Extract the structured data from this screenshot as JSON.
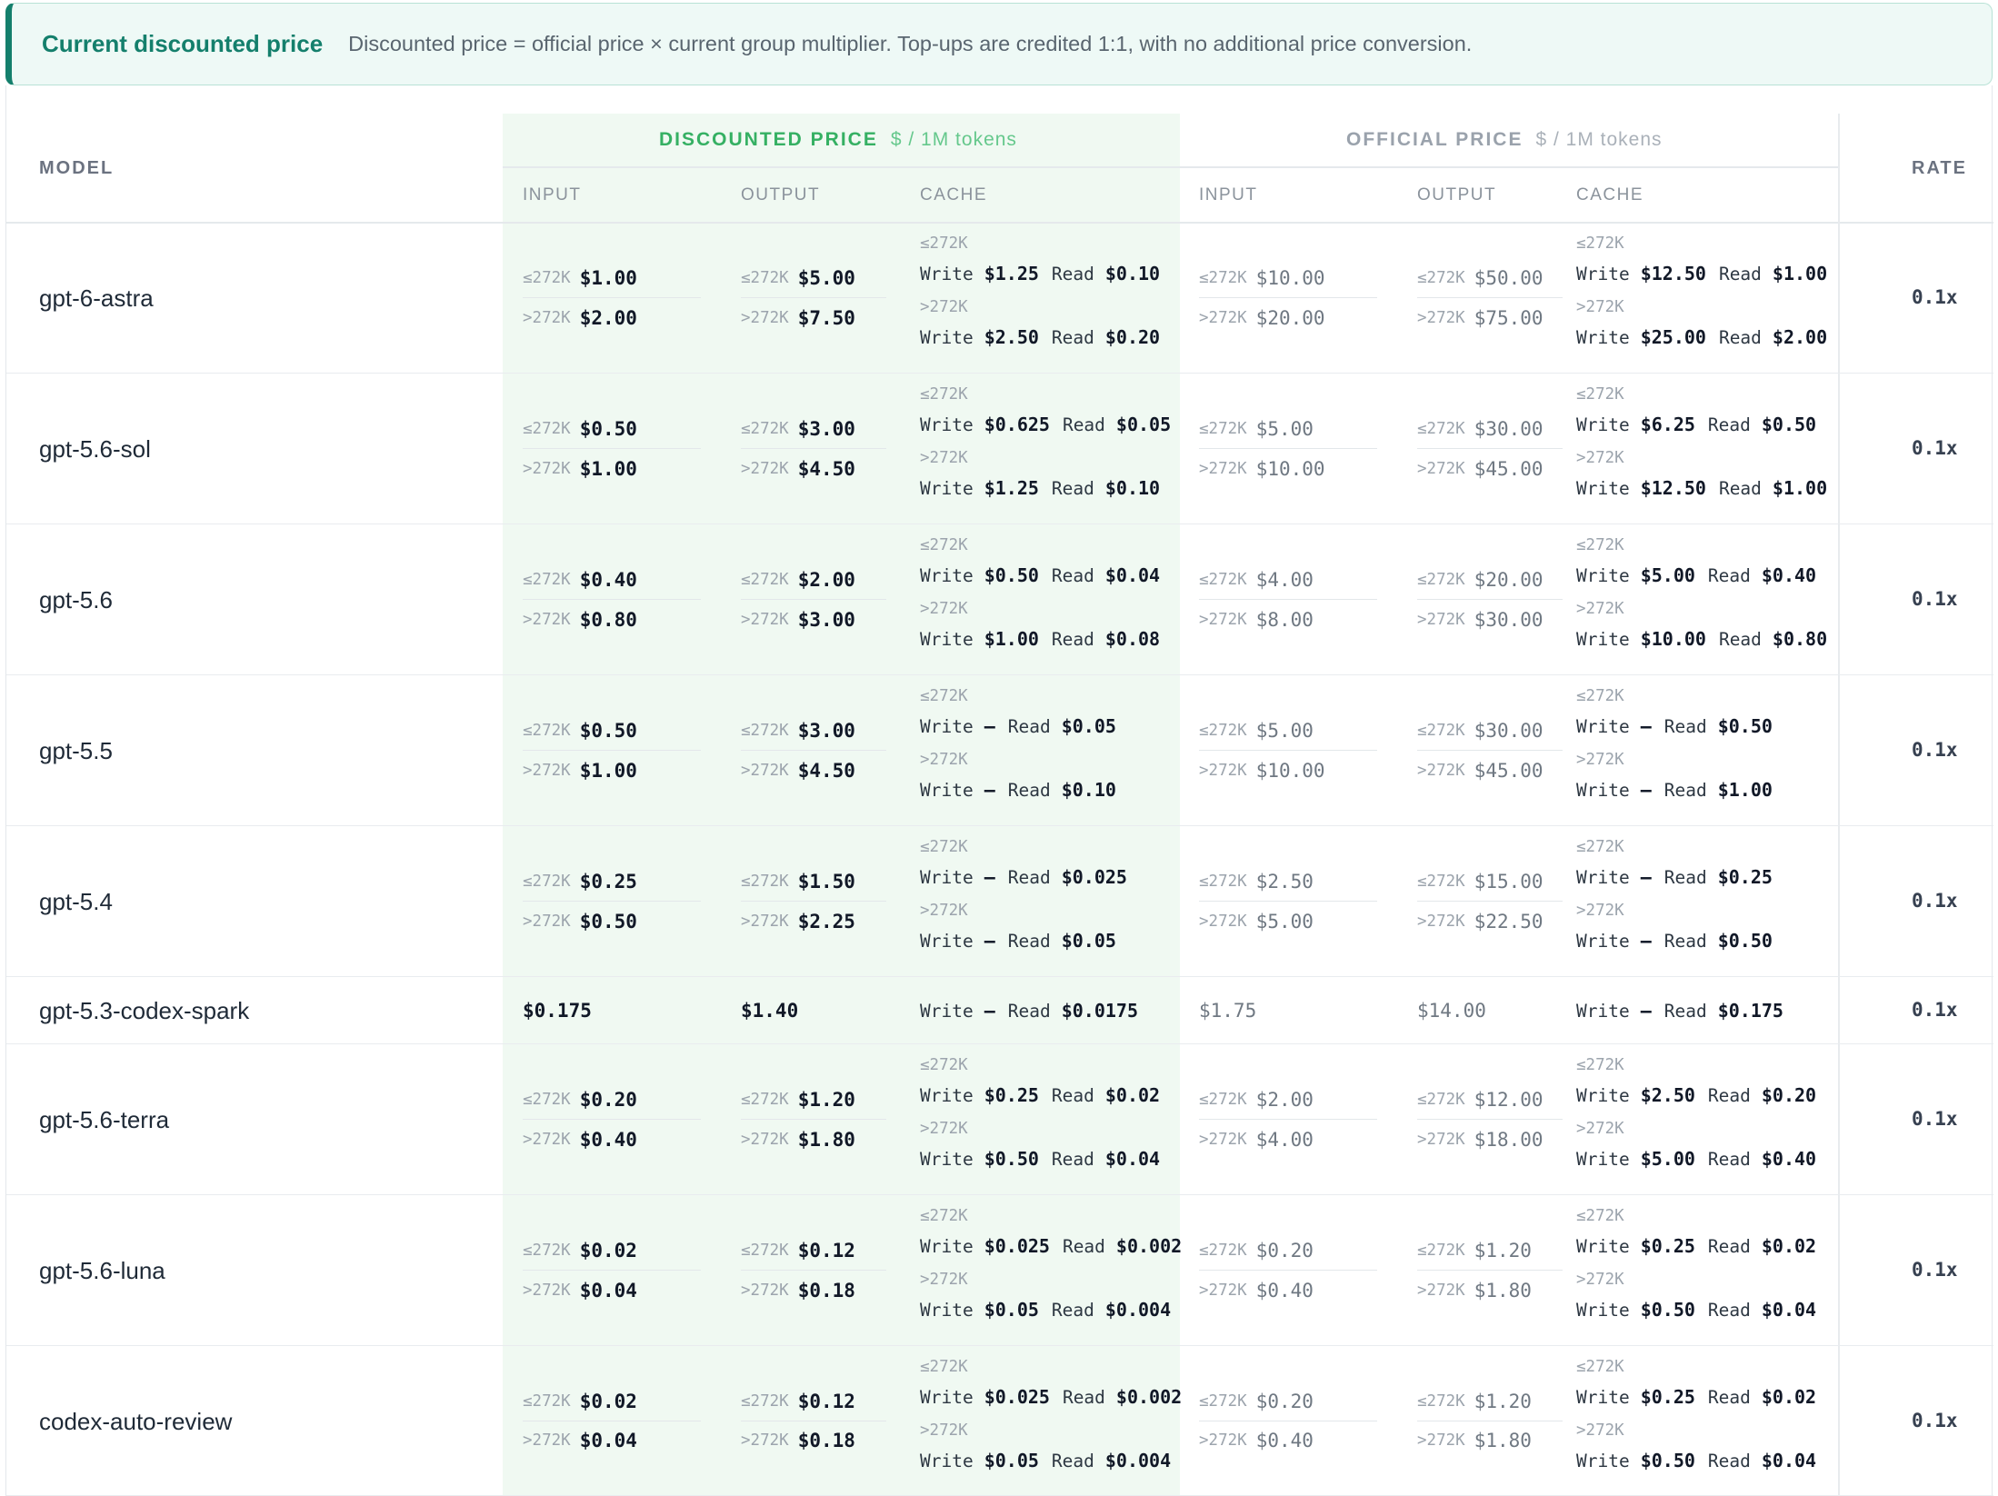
{
  "banner": {
    "title": "Current discounted price",
    "text": "Discounted price = official price × current group multiplier. Top-ups are credited 1:1, with no additional price conversion."
  },
  "header": {
    "model": "MODEL",
    "rate": "RATE",
    "discounted_title": "DISCOUNTED PRICE",
    "discounted_unit": "$ / 1M tokens",
    "official_title": "OFFICIAL PRICE",
    "official_unit": "$ / 1M tokens",
    "input": "INPUT",
    "output": "OUTPUT",
    "cache": "CACHE"
  },
  "labels": {
    "tier_low": "≤272K",
    "tier_high": ">272K",
    "write": "Write",
    "read": "Read"
  },
  "rows": [
    {
      "model": "gpt-6-astra",
      "rate": "0.1x",
      "disc": {
        "input": [
          "$1.00",
          "$2.00"
        ],
        "output": [
          "$5.00",
          "$7.50"
        ],
        "cache": [
          [
            "$1.25",
            "$0.10"
          ],
          [
            "$2.50",
            "$0.20"
          ]
        ]
      },
      "off": {
        "input": [
          "$10.00",
          "$20.00"
        ],
        "output": [
          "$50.00",
          "$75.00"
        ],
        "cache": [
          [
            "$12.50",
            "$1.00"
          ],
          [
            "$25.00",
            "$2.00"
          ]
        ]
      }
    },
    {
      "model": "gpt-5.6-sol",
      "rate": "0.1x",
      "disc": {
        "input": [
          "$0.50",
          "$1.00"
        ],
        "output": [
          "$3.00",
          "$4.50"
        ],
        "cache": [
          [
            "$0.625",
            "$0.05"
          ],
          [
            "$1.25",
            "$0.10"
          ]
        ]
      },
      "off": {
        "input": [
          "$5.00",
          "$10.00"
        ],
        "output": [
          "$30.00",
          "$45.00"
        ],
        "cache": [
          [
            "$6.25",
            "$0.50"
          ],
          [
            "$12.50",
            "$1.00"
          ]
        ]
      }
    },
    {
      "model": "gpt-5.6",
      "rate": "0.1x",
      "disc": {
        "input": [
          "$0.40",
          "$0.80"
        ],
        "output": [
          "$2.00",
          "$3.00"
        ],
        "cache": [
          [
            "$0.50",
            "$0.04"
          ],
          [
            "$1.00",
            "$0.08"
          ]
        ]
      },
      "off": {
        "input": [
          "$4.00",
          "$8.00"
        ],
        "output": [
          "$20.00",
          "$30.00"
        ],
        "cache": [
          [
            "$5.00",
            "$0.40"
          ],
          [
            "$10.00",
            "$0.80"
          ]
        ]
      }
    },
    {
      "model": "gpt-5.5",
      "rate": "0.1x",
      "disc": {
        "input": [
          "$0.50",
          "$1.00"
        ],
        "output": [
          "$3.00",
          "$4.50"
        ],
        "cache": [
          [
            "–",
            "$0.05"
          ],
          [
            "–",
            "$0.10"
          ]
        ]
      },
      "off": {
        "input": [
          "$5.00",
          "$10.00"
        ],
        "output": [
          "$30.00",
          "$45.00"
        ],
        "cache": [
          [
            "–",
            "$0.50"
          ],
          [
            "–",
            "$1.00"
          ]
        ]
      }
    },
    {
      "model": "gpt-5.4",
      "rate": "0.1x",
      "disc": {
        "input": [
          "$0.25",
          "$0.50"
        ],
        "output": [
          "$1.50",
          "$2.25"
        ],
        "cache": [
          [
            "–",
            "$0.025"
          ],
          [
            "–",
            "$0.05"
          ]
        ]
      },
      "off": {
        "input": [
          "$2.50",
          "$5.00"
        ],
        "output": [
          "$15.00",
          "$22.50"
        ],
        "cache": [
          [
            "–",
            "$0.25"
          ],
          [
            "–",
            "$0.50"
          ]
        ]
      }
    },
    {
      "model": "gpt-5.3-codex-spark",
      "rate": "0.1x",
      "flat": true,
      "disc": {
        "input": "$0.175",
        "output": "$1.40",
        "cache": [
          "–",
          "$0.0175"
        ]
      },
      "off": {
        "input": "$1.75",
        "output": "$14.00",
        "cache": [
          "–",
          "$0.175"
        ]
      }
    },
    {
      "model": "gpt-5.6-terra",
      "rate": "0.1x",
      "disc": {
        "input": [
          "$0.20",
          "$0.40"
        ],
        "output": [
          "$1.20",
          "$1.80"
        ],
        "cache": [
          [
            "$0.25",
            "$0.02"
          ],
          [
            "$0.50",
            "$0.04"
          ]
        ]
      },
      "off": {
        "input": [
          "$2.00",
          "$4.00"
        ],
        "output": [
          "$12.00",
          "$18.00"
        ],
        "cache": [
          [
            "$2.50",
            "$0.20"
          ],
          [
            "$5.00",
            "$0.40"
          ]
        ]
      }
    },
    {
      "model": "gpt-5.6-luna",
      "rate": "0.1x",
      "disc": {
        "input": [
          "$0.02",
          "$0.04"
        ],
        "output": [
          "$0.12",
          "$0.18"
        ],
        "cache": [
          [
            "$0.025",
            "$0.002"
          ],
          [
            "$0.05",
            "$0.004"
          ]
        ]
      },
      "off": {
        "input": [
          "$0.20",
          "$0.40"
        ],
        "output": [
          "$1.20",
          "$1.80"
        ],
        "cache": [
          [
            "$0.25",
            "$0.02"
          ],
          [
            "$0.50",
            "$0.04"
          ]
        ]
      }
    },
    {
      "model": "codex-auto-review",
      "rate": "0.1x",
      "disc": {
        "input": [
          "$0.02",
          "$0.04"
        ],
        "output": [
          "$0.12",
          "$0.18"
        ],
        "cache": [
          [
            "$0.025",
            "$0.002"
          ],
          [
            "$0.05",
            "$0.004"
          ]
        ]
      },
      "off": {
        "input": [
          "$0.20",
          "$0.40"
        ],
        "output": [
          "$1.20",
          "$1.80"
        ],
        "cache": [
          [
            "$0.25",
            "$0.02"
          ],
          [
            "$0.50",
            "$0.04"
          ]
        ]
      }
    }
  ]
}
